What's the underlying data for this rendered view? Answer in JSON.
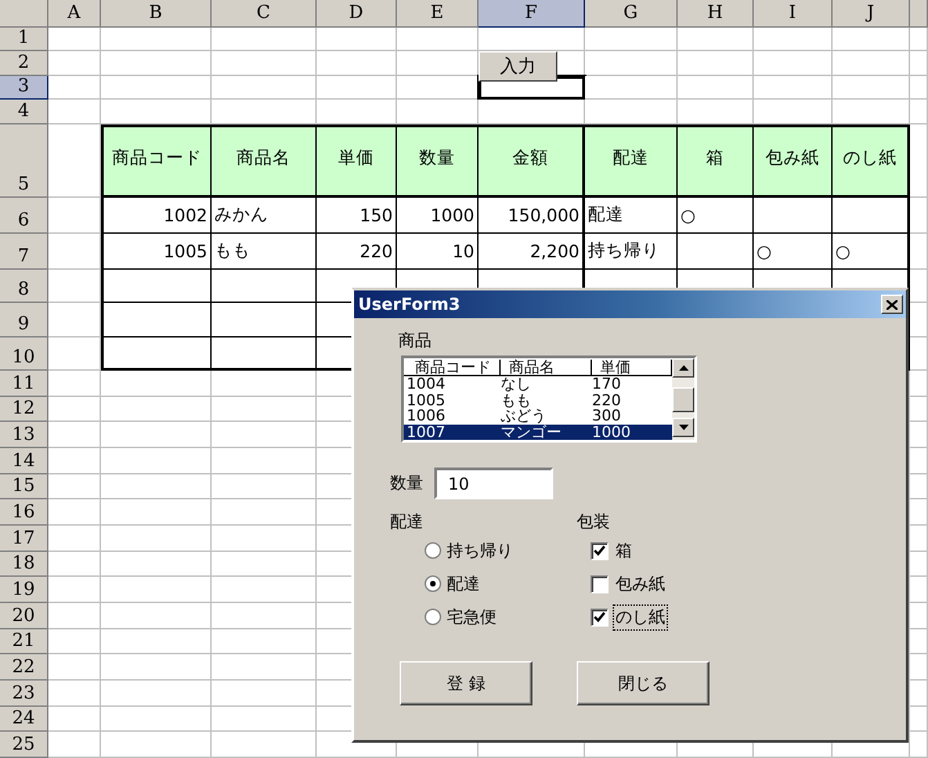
{
  "sheet": {
    "columns": [
      {
        "label": "A",
        "selected": false
      },
      {
        "label": "B",
        "selected": false
      },
      {
        "label": "C",
        "selected": false
      },
      {
        "label": "D",
        "selected": false
      },
      {
        "label": "E",
        "selected": false
      },
      {
        "label": "F",
        "selected": true
      },
      {
        "label": "G",
        "selected": false
      },
      {
        "label": "H",
        "selected": false
      },
      {
        "label": "I",
        "selected": false
      },
      {
        "label": "J",
        "selected": false
      }
    ],
    "rows": [
      {
        "label": "1",
        "selected": false
      },
      {
        "label": "2",
        "selected": false
      },
      {
        "label": "3",
        "selected": true
      },
      {
        "label": "4",
        "selected": false
      },
      {
        "label": "5",
        "selected": false
      },
      {
        "label": "6",
        "selected": false
      },
      {
        "label": "7",
        "selected": false
      },
      {
        "label": "8",
        "selected": false
      },
      {
        "label": "9",
        "selected": false
      },
      {
        "label": "10",
        "selected": false
      },
      {
        "label": "11",
        "selected": false
      },
      {
        "label": "12",
        "selected": false
      },
      {
        "label": "13",
        "selected": false
      },
      {
        "label": "14",
        "selected": false
      },
      {
        "label": "15",
        "selected": false
      },
      {
        "label": "16",
        "selected": false
      },
      {
        "label": "17",
        "selected": false
      },
      {
        "label": "18",
        "selected": false
      },
      {
        "label": "19",
        "selected": false
      },
      {
        "label": "20",
        "selected": false
      },
      {
        "label": "21",
        "selected": false
      },
      {
        "label": "22",
        "selected": false
      },
      {
        "label": "23",
        "selected": false
      },
      {
        "label": "24",
        "selected": false
      },
      {
        "label": "25",
        "selected": false
      }
    ],
    "sheet_button": {
      "label": "入力"
    }
  },
  "table": {
    "headers": [
      {
        "label": "商品コード",
        "kind": "number"
      },
      {
        "label": "商品名",
        "kind": "text"
      },
      {
        "label": "単価",
        "kind": "number"
      },
      {
        "label": "数量",
        "kind": "number"
      },
      {
        "label": "金額",
        "kind": "number"
      },
      {
        "label": "配達",
        "kind": "text"
      },
      {
        "label": "箱",
        "kind": "text"
      },
      {
        "label": "包み紙",
        "kind": "text"
      },
      {
        "label": "のし紙",
        "kind": "text"
      }
    ],
    "rows": [
      [
        "1002",
        "みかん",
        "150",
        "1000",
        "150,000",
        "配達",
        "○",
        null,
        null
      ],
      [
        "1005",
        "もも",
        "220",
        "10",
        "2,200",
        "持ち帰り",
        null,
        "○",
        "○"
      ],
      [
        null,
        null,
        null,
        null,
        null,
        null,
        null,
        null,
        null
      ],
      [
        null,
        null,
        null,
        null,
        null,
        null,
        null,
        null,
        null
      ],
      [
        null,
        null,
        null,
        null,
        null,
        null,
        null,
        null,
        null
      ]
    ]
  },
  "dialog": {
    "title": "UserForm3",
    "product_label": "商品",
    "product_list": {
      "columns": [
        "商品コード",
        "商品名",
        "単価"
      ],
      "rows": [
        {
          "cells": [
            "1004",
            "なし",
            "170"
          ],
          "selected": false
        },
        {
          "cells": [
            "1005",
            "もも",
            "220"
          ],
          "selected": false
        },
        {
          "cells": [
            "1006",
            "ぶどう",
            "300"
          ],
          "selected": false
        },
        {
          "cells": [
            "1007",
            "マンゴー",
            "1000"
          ],
          "selected": true
        }
      ]
    },
    "quantity": {
      "label": "数量",
      "value": "10"
    },
    "delivery": {
      "label": "配達",
      "options": [
        {
          "label": "持ち帰り",
          "selected": false
        },
        {
          "label": "配達",
          "selected": true
        },
        {
          "label": "宅急便",
          "selected": false
        }
      ]
    },
    "packaging": {
      "label": "包装",
      "options": [
        {
          "label": "箱",
          "checked": true,
          "focused": false
        },
        {
          "label": "包み紙",
          "checked": false,
          "focused": false
        },
        {
          "label": "のし紙",
          "checked": true,
          "focused": true
        }
      ]
    },
    "buttons": [
      "登 録",
      "閉じる"
    ]
  }
}
